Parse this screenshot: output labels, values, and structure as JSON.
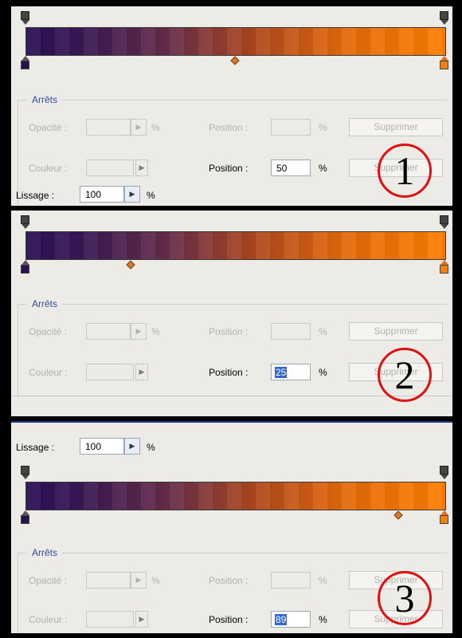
{
  "colors": {
    "gradient_start": "#2a0f55",
    "gradient_end": "#ff7e00",
    "accent": "#2e4da8",
    "badge": "#e01010"
  },
  "panels": [
    {
      "group_title": "Arrêts",
      "opacity_label": "Opacité :",
      "opacity_value": "",
      "pct": "%",
      "opacity_position_label": "Position :",
      "opacity_position_value": "",
      "delete_label": "Supprimer",
      "color_label": "Couleur :",
      "color_position_label": "Position :",
      "color_position_value": "50",
      "smoothing_label": "Lissage :",
      "smoothing_value": "100",
      "badge_number": "1",
      "midpoint_percent": 50
    },
    {
      "group_title": "Arrêts",
      "opacity_label": "Opacité :",
      "pct": "%",
      "opacity_position_label": "Position :",
      "delete_label": "Supprimer",
      "color_label": "Couleur :",
      "color_position_label": "Position :",
      "color_position_value": "25",
      "badge_number": "2",
      "midpoint_percent": 25
    },
    {
      "group_title": "Arrêts",
      "opacity_label": "Opacité :",
      "pct": "%",
      "opacity_position_label": "Position :",
      "delete_label": "Supprimer",
      "color_label": "Couleur :",
      "color_position_label": "Position :",
      "color_position_value": "89",
      "smoothing_label": "Lissage :",
      "smoothing_value": "100",
      "badge_number": "3",
      "midpoint_percent": 89
    }
  ]
}
